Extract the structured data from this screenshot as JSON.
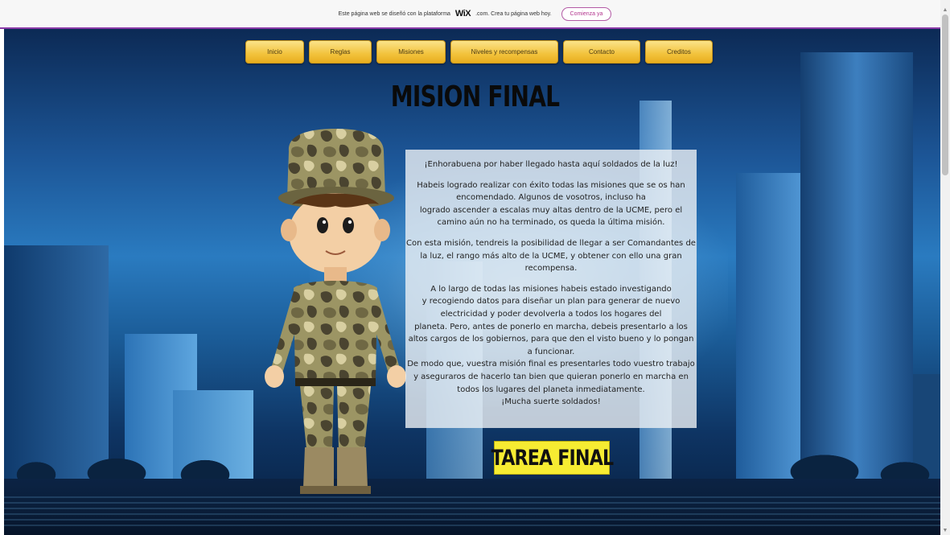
{
  "banner": {
    "text": "Este página web se diseñó con la plataforma",
    "logo": "WiX",
    "text_after": ".com. Crea tu página web hoy.",
    "cta": "Comienza ya"
  },
  "nav": [
    {
      "label": "Inicio"
    },
    {
      "label": "Reglas"
    },
    {
      "label": "Misiones"
    },
    {
      "label": "Niveles y recompensas"
    },
    {
      "label": "Contacto"
    },
    {
      "label": "Creditos"
    }
  ],
  "title": "MISION FINAL",
  "body": [
    "¡Enhorabuena por haber llegado hasta aquí soldados de  la luz!",
    "",
    "Habeis logrado realizar con éxito todas las misiones que se os han encomendado. Algunos de vosotros, incluso  ha",
    "logrado ascender a escalas muy altas dentro de la UCME, pero el camino aún no ha terminado, os queda la última misión.",
    "",
    "Con esta misión, tendreis la posibilidad de llegar a ser Comandantes de la luz, el rango más alto de la UCME, y obtener con ello una gran recompensa.",
    "",
    "A lo largo de todas las misiones habeis estado investigando",
    "y recogiendo datos para diseñar un plan para generar de nuevo electricidad y poder devolverla a todos los hogares del",
    "planeta. Pero, antes de ponerlo en marcha, debeis presentarlo a los altos cargos de los gobiernos, para que den el visto bueno y lo pongan a funcionar.",
    "De modo que, vuestra misión final es presentarles todo vuestro trabajo y aseguraros de hacerlo tan bien que quieran ponerlo en marcha en todos los lugares del planeta inmediatamente.",
    "¡Mucha suerte soldados!"
  ],
  "cta": "TAREA FINAL",
  "colors": {
    "nav": "#f2c23c",
    "cta": "#f6ec32",
    "banner_border": "#8a3aa8"
  }
}
